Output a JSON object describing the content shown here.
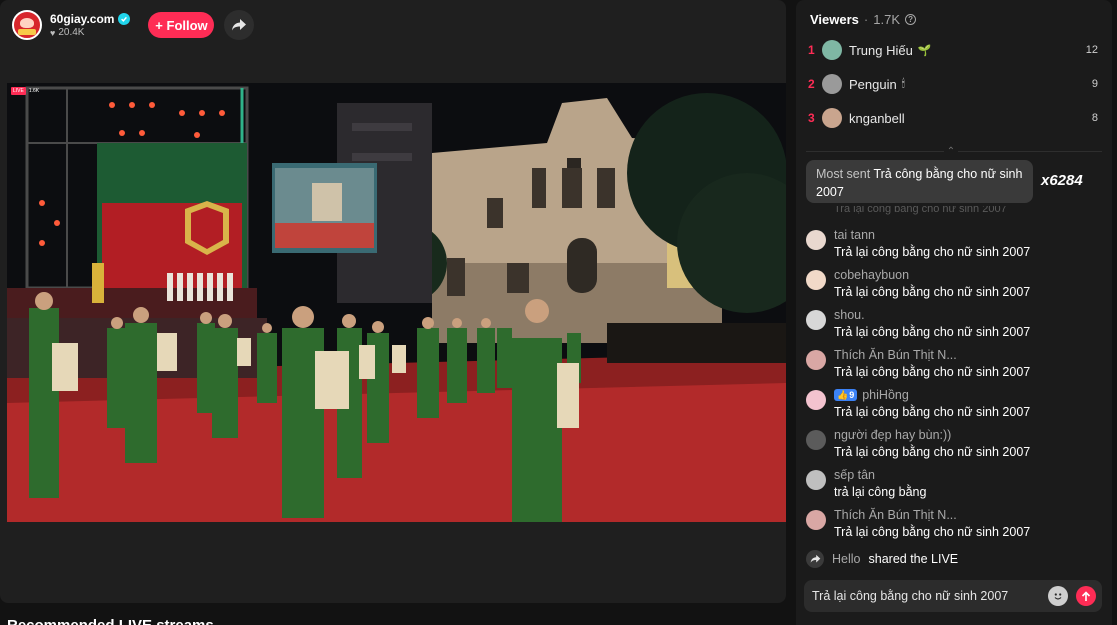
{
  "host": {
    "name": "60giay.com",
    "likes": "20.4K",
    "follow_label": "+ Follow"
  },
  "video": {
    "live_badge": "LIVE",
    "live_viewers": "1.6K"
  },
  "recommended_title": "Recommended LIVE streams",
  "viewers": {
    "title": "Viewers",
    "count": "1.7K",
    "top": [
      {
        "rank": "1",
        "name": "Trung Hiếu",
        "badge": "🌱",
        "score": "12",
        "avatar_color": "#7fb7a4"
      },
      {
        "rank": "2",
        "name": "Penguin",
        "badge": "🕯",
        "score": "9",
        "avatar_color": "#9a9a9a"
      },
      {
        "rank": "3",
        "name": "knganbell",
        "badge": "",
        "score": "8",
        "avatar_color": "#c9a58e"
      }
    ]
  },
  "most_sent": {
    "label": "Most sent",
    "text": "Trả công bằng cho nữ sinh 2007",
    "count": "x6284"
  },
  "faded_line": "Trả lại công bằng cho nữ sinh 2007",
  "messages": [
    {
      "user": "tai tann",
      "text": "Trả lại công bằng cho nữ sinh 2007",
      "avatar_color": "#e9d8cf",
      "level": ""
    },
    {
      "user": "cobehaybuon",
      "text": "Trả lại công bằng cho nữ sinh 2007",
      "avatar_color": "#f1d9c8",
      "level": ""
    },
    {
      "user": "shou.",
      "text": "Trả lại công bằng cho nữ sinh 2007",
      "avatar_color": "#d7d7d7",
      "level": ""
    },
    {
      "user": "Thích Ăn Bún Thịt N...",
      "text": "Trả lại công bằng cho nữ sinh 2007",
      "avatar_color": "#d9a7a4",
      "level": ""
    },
    {
      "user": "phiHồng",
      "text": "Trả lại công bằng cho nữ sinh 2007",
      "avatar_color": "#f3c3cf",
      "level": "9"
    },
    {
      "user": "người đẹp hay bùn:))",
      "text": "Trả lại công bằng cho nữ sinh 2007",
      "avatar_color": "#5b5b5b",
      "level": ""
    },
    {
      "user": "sếp tân",
      "text": "trả lại công bằng",
      "avatar_color": "#bfbfbf",
      "level": ""
    },
    {
      "user": "Thích Ăn Bún Thịt N...",
      "text": "Trả lại công bằng cho nữ sinh 2007",
      "avatar_color": "#d9a7a4",
      "level": ""
    }
  ],
  "share_event": {
    "user": "Hello",
    "text": "shared the LIVE"
  },
  "chat_input": {
    "value": "Trả lại công bằng cho nữ sinh 2007"
  },
  "colors": {
    "accent": "#fe2c55",
    "verified": "#20d5ec",
    "panel_bg": "#1b1b1b"
  }
}
